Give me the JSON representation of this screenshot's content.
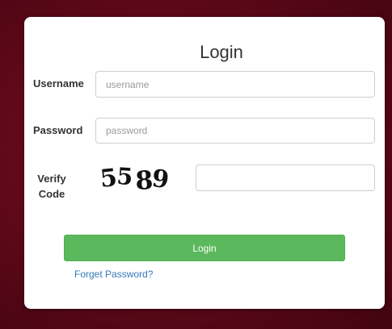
{
  "login_form": {
    "title": "Login",
    "username_label": "Username",
    "username_placeholder": "username",
    "password_label": "Password",
    "password_placeholder": "password",
    "verify_label_line1": "Verify",
    "verify_label_line2": "Code",
    "captcha_text": "5589",
    "verify_value": "",
    "submit_label": "Login",
    "forgot_link": "Forget Password?"
  },
  "colors": {
    "background": "#5c0818",
    "button": "#5cb85c",
    "link": "#337ab7"
  }
}
